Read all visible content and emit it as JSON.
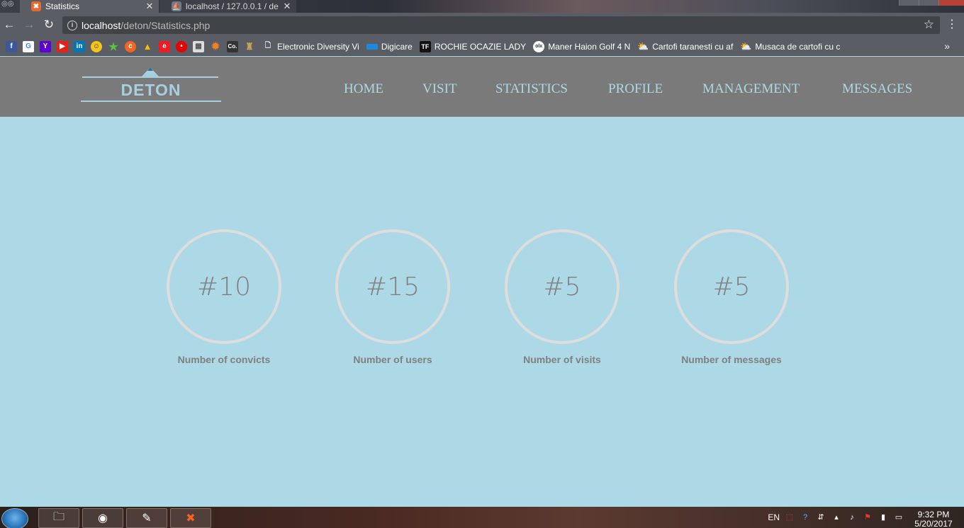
{
  "browser": {
    "tabs": [
      {
        "title": "Statistics",
        "active": true
      },
      {
        "title": "localhost / 127.0.0.1 / de",
        "active": false
      }
    ],
    "url_host": "localhost",
    "url_path": "/deton/Statistics.php",
    "icons": {
      "back": "arrow-left-icon",
      "forward": "arrow-right-icon",
      "reload": "reload-icon",
      "bookmark_star": "star-icon",
      "menu": "vertical-dots-icon"
    },
    "bookmarks": [
      {
        "label": "Electronic Diversity Vi",
        "icon": "page-icon"
      },
      {
        "label": "Digicare",
        "icon": "digicare-icon"
      },
      {
        "label": "ROCHIE OCAZIE LADY",
        "icon": "tf-icon"
      },
      {
        "label": "Maner Haion Golf 4 N",
        "icon": "olx-icon"
      },
      {
        "label": "Cartofi taranesti cu af",
        "icon": "recipe-icon"
      },
      {
        "label": "Musaca de cartofi cu c",
        "icon": "recipe-icon"
      }
    ],
    "bookmark_icons": [
      "facebook-icon",
      "google-icon",
      "yahoo-icon",
      "youtube-icon",
      "linkedin-icon",
      "emoji-icon",
      "star-green-icon",
      "circle-orange-icon",
      "drive-icon",
      "emag-icon",
      "vodafone-icon",
      "grid-icon",
      "sun-icon",
      "co-icon",
      "castle-icon"
    ]
  },
  "site": {
    "logo_text": "DETON",
    "nav": [
      "HOME",
      "VISIT",
      "STATISTICS",
      "PROFILE",
      "MANAGEMENT",
      "MESSAGES"
    ],
    "stats": [
      {
        "value": "#10",
        "label": "Number of convicts"
      },
      {
        "value": "#15",
        "label": "Number of users"
      },
      {
        "value": "#5",
        "label": "Number of visits"
      },
      {
        "value": "#5",
        "label": "Number of messages"
      }
    ],
    "colors": {
      "background": "#add8e6",
      "header": "#7a7a7a",
      "nav_text": "#add8e6",
      "circle_border": "#dddddd",
      "stat_text": "#808080"
    }
  },
  "taskbar": {
    "apps": [
      "explorer-icon",
      "chrome-icon",
      "notepad-icon",
      "xampp-icon"
    ],
    "language": "EN",
    "time": "9:32 PM",
    "date": "5/20/2017"
  }
}
